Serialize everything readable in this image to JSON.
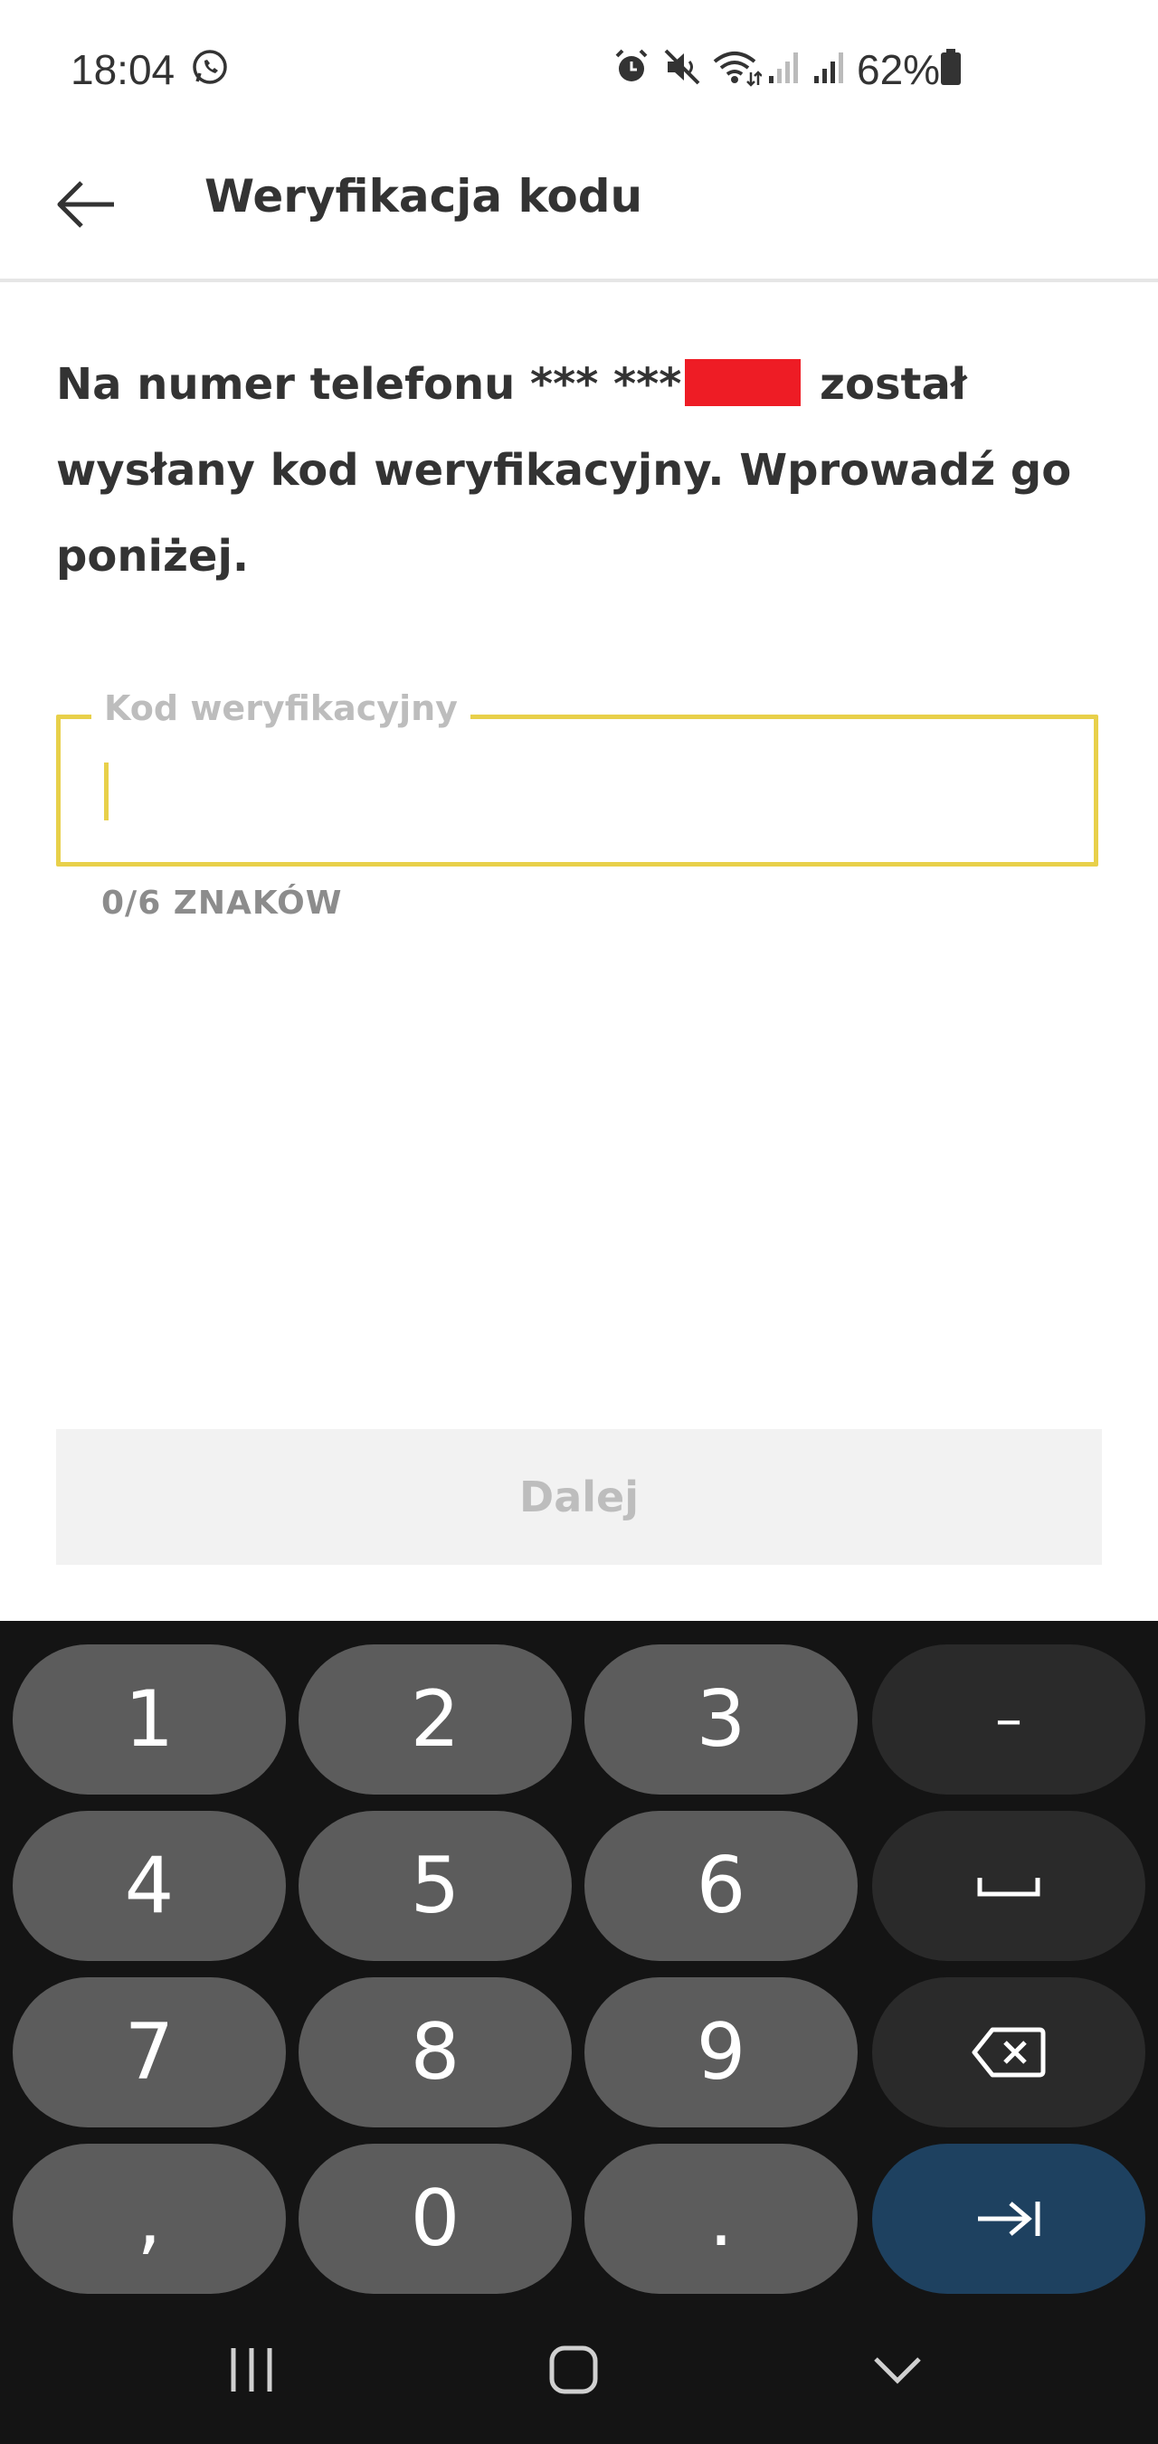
{
  "status_bar": {
    "time": "18:04",
    "battery": "62%",
    "icons": [
      "whatsapp-icon",
      "alarm-icon",
      "mute-icon",
      "wifi-icon",
      "signal-icon",
      "signal-icon",
      "battery-icon"
    ]
  },
  "app_bar": {
    "title": "Weryfikacja kodu"
  },
  "instruction": {
    "before": "Na numer telefonu *** ***",
    "after": " został wysłany kod weryfikacyjny. Wprowadź go poniżej."
  },
  "code_field": {
    "label": "Kod weryfikacyjny",
    "value": "",
    "counter": "0/6 ZNAKÓW"
  },
  "next_button": {
    "label": "Dalej"
  },
  "keyboard": {
    "row1": [
      "1",
      "2",
      "3",
      "–"
    ],
    "row2": [
      "4",
      "5",
      "6"
    ],
    "row3": [
      "7",
      "8",
      "9"
    ],
    "row4": [
      ",",
      "0",
      "."
    ]
  },
  "colors": {
    "accent": "#e8d04a",
    "redaction": "#ee1c25",
    "enter_key": "#1e4160"
  }
}
